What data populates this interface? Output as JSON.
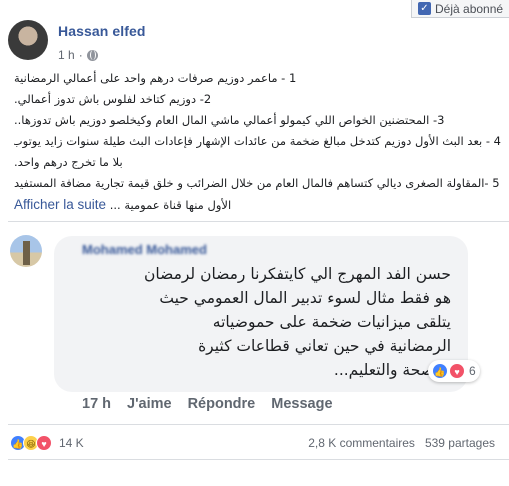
{
  "follow": {
    "label": "Déjà abonné"
  },
  "post": {
    "author": "Hassan elfed",
    "time": "1 h",
    "separator": "·",
    "lines": [
      "1 - ماعمر دوزيم صرفات درهم واحد على أعمالي الرمضانية",
      "2- دوزيم كتاخد لفلوس باش تدوز أعمالي.",
      "3- المحتضنين الخواص اللي كيمولو أعمالي ماشي المال العام وكيخلصو دوزيم باش تدوزها..",
      "4 - بعد البث الأول دوزيم كتدخل مبالغ ضخمة من عائدات الإشهار فإعادات البث طيلة سنوات زايد يوتوب",
      "بلا ما تخرج درهم واحد.",
      "5 -المقاولة الصغرى ديالي كتساهم فالمال العام من خلال الضرائب و خلق قيمة تجارية مضافة المستفيد",
      "الأول منها قناة عمومية ..."
    ],
    "see_more": "Afficher la suite"
  },
  "comment": {
    "author": "Mohamed Mohamed",
    "lines": [
      "حسن الفد المهرج الي كايتفكرنا رمضان لرمضان",
      "هو فقط مثال لسوء تدبير المال العمومي حيث",
      "يتلقى ميزانيات ضخمة على حموضياته",
      "الرمضانية في حين تعاني قطاعات كثيرة",
      "كالصحة والتعليم..."
    ],
    "reaction_count": "6",
    "time": "17 h",
    "like_label": "J'aime",
    "reply_label": "Répondre",
    "message_label": "Message"
  },
  "stats": {
    "reactions_count": "14 K",
    "comments": "2,8 K commentaires",
    "shares": "539 partages"
  },
  "icons": {
    "like": "thumbs-up-icon",
    "love": "heart-icon",
    "haha": "laugh-icon",
    "privacy": "globe-icon"
  },
  "colors": {
    "link": "#385898",
    "like": "#4080ff",
    "love": "#f25268",
    "haha": "#fcd04b"
  }
}
